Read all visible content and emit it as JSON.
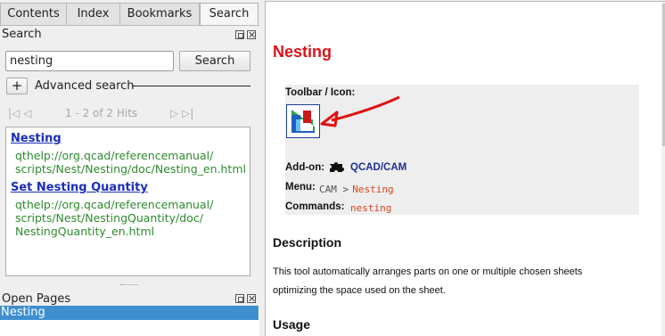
{
  "tabs": [
    {
      "label": "Contents"
    },
    {
      "label": "Index"
    },
    {
      "label": "Bookmarks"
    },
    {
      "label": "Search",
      "active": true
    }
  ],
  "search_dock": {
    "title": "Search",
    "query": "nesting",
    "search_button": "Search",
    "add_button": "+",
    "advanced_label": "Advanced search",
    "nav_first_prev": "|◁ ◁",
    "nav_next_last": "▷ ▷|",
    "hits": "1 - 2 of 2 Hits"
  },
  "results": [
    {
      "title": "Nesting",
      "url_lines": [
        "qthelp://org.qcad/referencemanual/",
        "scripts/Nest/Nesting/doc/Nesting_en.html"
      ]
    },
    {
      "title": "Set Nesting Quantity",
      "url_lines": [
        "qthelp://org.qcad/referencemanual/",
        "scripts/Nest/NestingQuantity/doc/",
        "NestingQuantity_en.html"
      ]
    }
  ],
  "open_pages": {
    "title": "Open Pages",
    "items": [
      "Nesting"
    ]
  },
  "article": {
    "title": "Nesting",
    "toolbar_label": "Toolbar / Icon:",
    "addon_label": "Add-on:",
    "addon_value": "QCAD/CAM",
    "menu_label": "Menu:",
    "menu_path": "CAM >",
    "menu_item": "Nesting",
    "commands_label": "Commands:",
    "command": "nesting",
    "description_heading": "Description",
    "description_line1": "This tool automatically arranges parts on one or multiple chosen sheets",
    "description_line2": "optimizing the space used on the sheet.",
    "usage_heading": "Usage"
  },
  "colors": {
    "heading_red": "#d8141c",
    "link_blue": "#1a2db8",
    "url_green": "#2e8b2e",
    "selection_blue": "#3d8fcf",
    "annotation_arrow": "#e01010"
  }
}
